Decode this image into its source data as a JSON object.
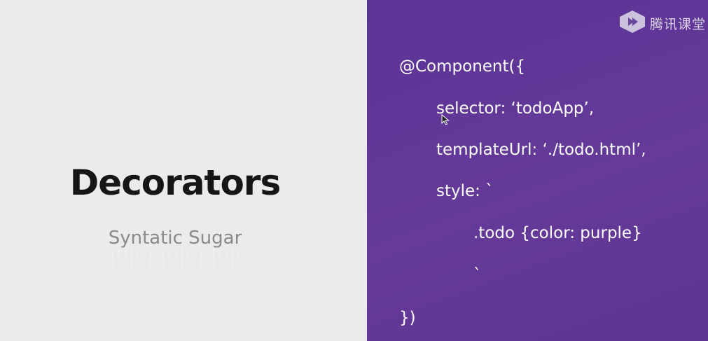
{
  "slide": {
    "title": "Decorators",
    "subtitle": "Syntatic Sugar",
    "code_lines": [
      "@Component({",
      "selector: ‘todoApp’,",
      "templateUrl: ‘./todo.html’,",
      "style: `",
      ".todo {color: purple}",
      "`",
      "})"
    ]
  },
  "watermark": {
    "text": "腾讯课堂",
    "icon": "tencent-classroom-logo-icon"
  },
  "colors": {
    "left_background": "#ebebeb",
    "right_background": "#613795",
    "title_color": "#161616",
    "subtitle_color": "#8a8a8a",
    "code_color": "#ffffff"
  }
}
